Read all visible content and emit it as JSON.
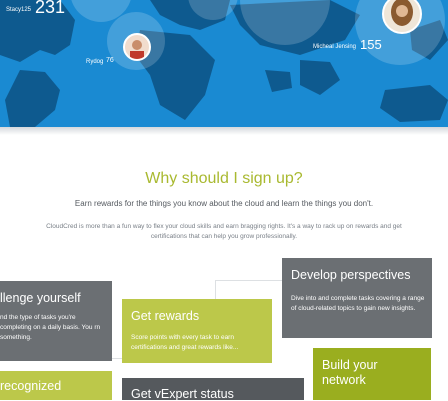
{
  "colors": {
    "hero_blue": "#1a8ad2",
    "heading_green": "#a9b930",
    "card_gray": "#6b6f73",
    "card_lime": "#bcc84a",
    "card_olive": "#9aae1f",
    "card_dark": "#55595d"
  },
  "leaderboard": [
    {
      "name": "Stacy125",
      "score": "231"
    },
    {
      "name": "Rydog",
      "score": "76"
    },
    {
      "name": "Micheal Jensing",
      "score": "155"
    }
  ],
  "section": {
    "title": "Why should I sign up?",
    "subtitle": "Earn rewards for the things you know about the cloud and learn the things you don't.",
    "description": "CloudCred is more than a fun way to flex your cloud skills and earn bragging rights. It's a way to rack up on rewards and get certifications that can help you grow professionally."
  },
  "cards": {
    "challenge": {
      "title": "llenge yourself",
      "body": "nd the type of tasks you're completing on a daily basis. You rn something."
    },
    "rewards": {
      "title": "Get rewards",
      "body": "Score points with every task to earn certifications and great rewards like..."
    },
    "perspectives": {
      "title": "Develop perspectives",
      "body": "Dive into and complete tasks covering a range of cloud-related topics to gain new insights."
    },
    "network": {
      "title": "Build your network"
    },
    "recognized": {
      "title": "recognized"
    },
    "vexpert": {
      "title": "Get vExpert status"
    }
  }
}
